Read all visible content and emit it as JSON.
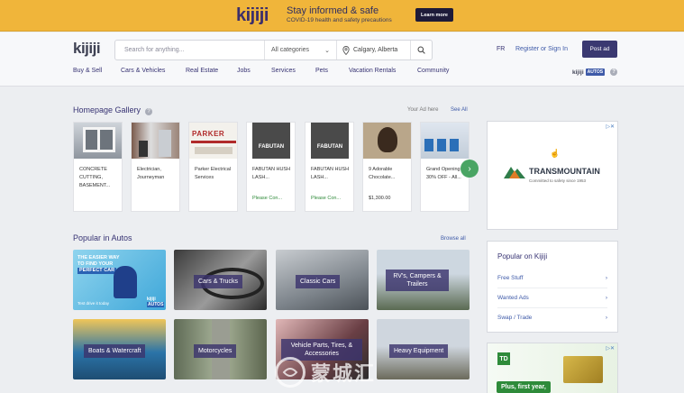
{
  "banner": {
    "logo": "kijiji",
    "title": "Stay informed & safe",
    "subtitle": "COVID-19 health and safety precautions",
    "button": "Learn more"
  },
  "header": {
    "logo": "kijiji",
    "search_placeholder": "Search for anything...",
    "category": "All categories",
    "location": "Calgary, Alberta",
    "lang": "FR",
    "register": "Register or Sign In",
    "post_ad": "Post ad",
    "autos_brand": "kijiji",
    "autos_tag": "AUTOS"
  },
  "nav": [
    "Buy & Sell",
    "Cars & Vehicles",
    "Real Estate",
    "Jobs",
    "Services",
    "Pets",
    "Vacation Rentals",
    "Community"
  ],
  "gallery": {
    "title": "Homepage Gallery",
    "your_ad": "Your Ad here",
    "see_all": "See All",
    "cards": [
      {
        "title": "CONCRETE CUTTING, BASEMENT...",
        "price": ""
      },
      {
        "title": "Electrician, Journeyman",
        "price": ""
      },
      {
        "title": "Parker Electrical Services",
        "price": ""
      },
      {
        "title": "FABUTAN HUSH LASH...",
        "price": "Please Con..."
      },
      {
        "title": "FABUTAN HUSH LASH...",
        "price": "Please Con..."
      },
      {
        "title": "9 Adorable Chocolate...",
        "price": "$1,300.00"
      },
      {
        "title": "Grand Opening - 30% OFF - All...",
        "price": ""
      }
    ],
    "card_logos": {
      "parker": "PARKER",
      "fabutan": "FABUTAN"
    }
  },
  "ad": {
    "brand": "TRANSMOUNTAIN",
    "tagline": "Committed to safety since 1953"
  },
  "popular_kijiji": {
    "title": "Popular on Kijiji",
    "items": [
      "Free Stuff",
      "Wanted Ads",
      "Swap / Trade"
    ]
  },
  "td_ad": {
    "logo": "TD",
    "text": "Plus, first year,"
  },
  "autos": {
    "title": "Popular in Autos",
    "browse": "Browse all",
    "promo": {
      "line1": "THE EASIER WAY",
      "line2": "TO FIND YOUR",
      "line3": "PERFECT CAR",
      "cta": "Test drive it today",
      "brand": "kijiji",
      "tag": "AUTOS"
    },
    "tiles": [
      "Cars & Trucks",
      "Classic Cars",
      "RV's, Campers & Trailers",
      "Boats & Watercraft",
      "Motorcycles",
      "Vehicle Parts, Tires, & Accessories",
      "Heavy Equipment"
    ]
  },
  "watermark": "蒙城汇"
}
